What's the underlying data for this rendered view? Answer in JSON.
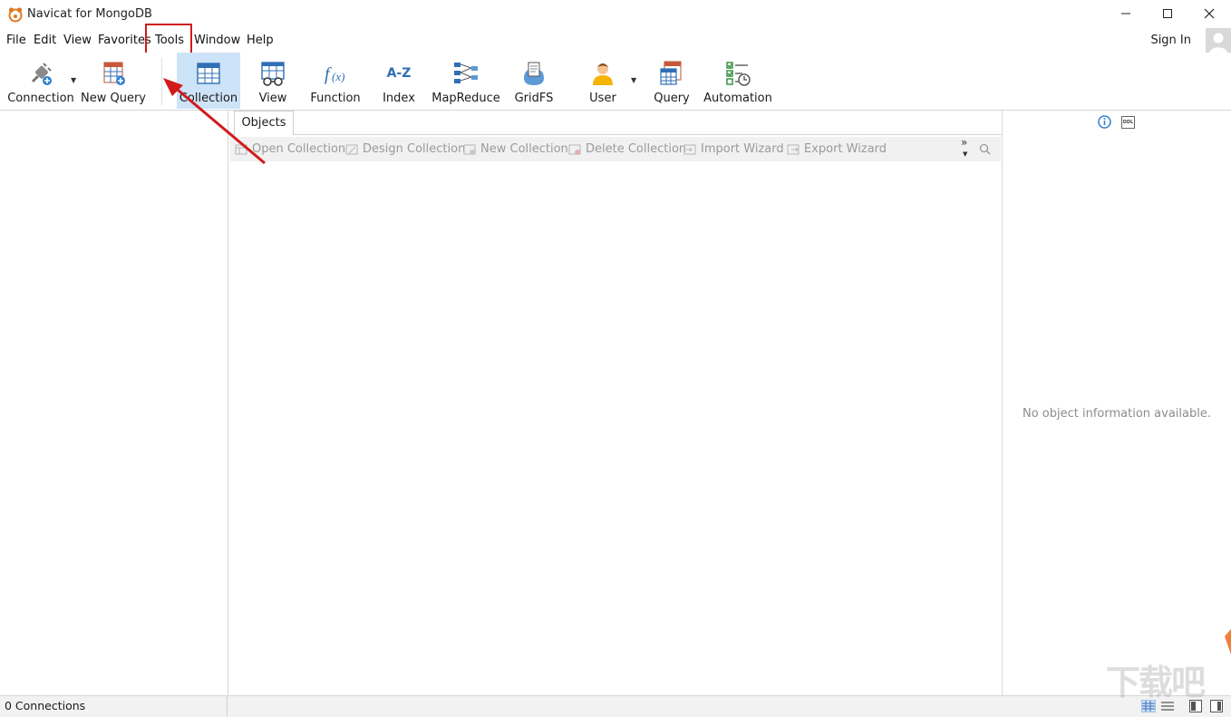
{
  "window": {
    "title": "Navicat for MongoDB"
  },
  "menu": {
    "items": [
      "File",
      "Edit",
      "View",
      "Favorites",
      "Tools",
      "Window",
      "Help"
    ],
    "sign_in": "Sign In"
  },
  "toolbar": {
    "connection": "Connection",
    "new_query": "New Query",
    "collection": "Collection",
    "view": "View",
    "function": "Function",
    "index": "Index",
    "index_icon_text": "A-Z",
    "mapreduce": "MapReduce",
    "gridfs": "GridFS",
    "user": "User",
    "query": "Query",
    "automation": "Automation"
  },
  "tabs": {
    "objects": "Objects"
  },
  "object_toolbar": {
    "open": "Open Collection",
    "design": "Design Collection",
    "new": "New Collection",
    "delete": "Delete Collection",
    "import": "Import Wizard",
    "export": "Export Wizard"
  },
  "info_panel": {
    "message": "No object information available.",
    "ddl_icon_text": "DDL"
  },
  "status": {
    "connections": "0 Connections"
  },
  "watermark": "下载吧",
  "colors": {
    "highlight_red": "#d11b1b",
    "selected_tool": "#cde3f7",
    "accent_blue": "#2f7fd1"
  }
}
